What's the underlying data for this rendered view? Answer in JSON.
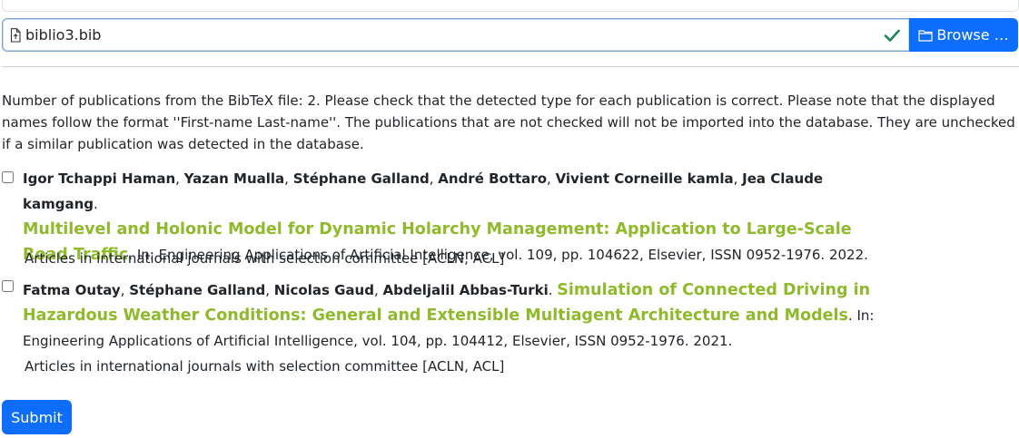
{
  "file": {
    "name": "biblio3.bib",
    "browse_label": "Browse …"
  },
  "info_text": "Number of publications from the BibTeX file: 2. Please check that the detected type for each publication is correct. Please note that the displayed names follow the format ''First-name Last-name''. The publications that are not checked will not be imported into the database. They are unchecked if a similar publication was detected in the database.",
  "publications": [
    {
      "checked": false,
      "authors": [
        "Igor Tchappi Haman",
        "Yazan Mualla",
        "Stéphane Galland",
        "André Bottaro",
        "Vivient Corneille kamla",
        "Jea Claude kamgang"
      ],
      "title": "Multilevel and Holonic Model for Dynamic Holarchy Management: Application to Large-Scale Road Traffic",
      "details": "In: Engineering Applications of Artificial Intelligence, vol. 109, pp. 104622, Elsevier, ISSN 0952-1976. 2022.",
      "category": "Articles in international journals with selection committee [ACLN, ACL]"
    },
    {
      "checked": false,
      "authors": [
        "Fatma Outay",
        "Stéphane Galland",
        "Nicolas Gaud",
        "Abdeljalil Abbas-Turki"
      ],
      "title": "Simulation of Connected Driving in Hazardous Weather Conditions: General and Extensible Multiagent Architecture and Models",
      "details": "In: Engineering Applications of Artificial Intelligence, vol. 104, pp. 104412, Elsevier, ISSN 0952-1976. 2021.",
      "category": "Articles in international journals with selection committee [ACLN, ACL]"
    }
  ],
  "submit_label": "Submit",
  "colors": {
    "primary": "#0d6efd",
    "title_green": "#8fba2b",
    "valid_green": "#198754"
  }
}
